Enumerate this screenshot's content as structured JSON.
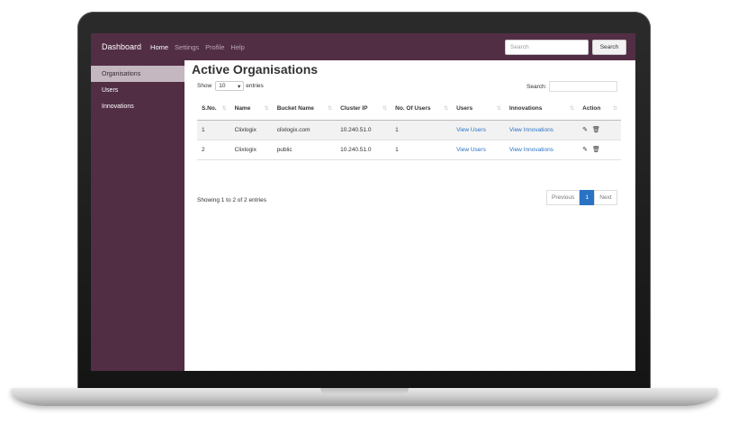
{
  "navbar": {
    "brand": "Dashboard",
    "links": [
      "Home",
      "Settings",
      "Profile",
      "Help"
    ],
    "search_placeholder": "Search",
    "search_button": "Search"
  },
  "sidebar": {
    "items": [
      "Organisations",
      "Users",
      "Innovations"
    ]
  },
  "main": {
    "title": "Active Organisations",
    "show_label": "Show",
    "entries_value": "10",
    "entries_label": "entries",
    "search_label": "Search:",
    "columns": [
      "S.No.",
      "Name",
      "Bucket Name",
      "Cluster IP",
      "No. Of Users",
      "Users",
      "Innovations",
      "Action"
    ],
    "rows": [
      {
        "sno": "1",
        "name": "Clixlogix",
        "bucket": "clixlogix.com",
        "ip": "10.240.51.0",
        "users_count": "1",
        "users_link": "View Users",
        "innov_link": "View Innovations"
      },
      {
        "sno": "2",
        "name": "Clixlogix",
        "bucket": "public",
        "ip": "10.240.51.0",
        "users_count": "1",
        "users_link": "View Users",
        "innov_link": "View Innovations"
      }
    ],
    "info": "Showing 1 to 2 of 2 entries",
    "pagination": {
      "prev": "Previous",
      "page": "1",
      "next": "Next"
    }
  },
  "colors": {
    "accent": "#522e45",
    "link": "#2a73c4",
    "sidebar_active": "#c4b7c0"
  },
  "icons": {
    "sort": "sort-arrows-icon",
    "edit": "edit-icon",
    "delete": "trash-icon",
    "dropdown": "caret-down-icon"
  }
}
